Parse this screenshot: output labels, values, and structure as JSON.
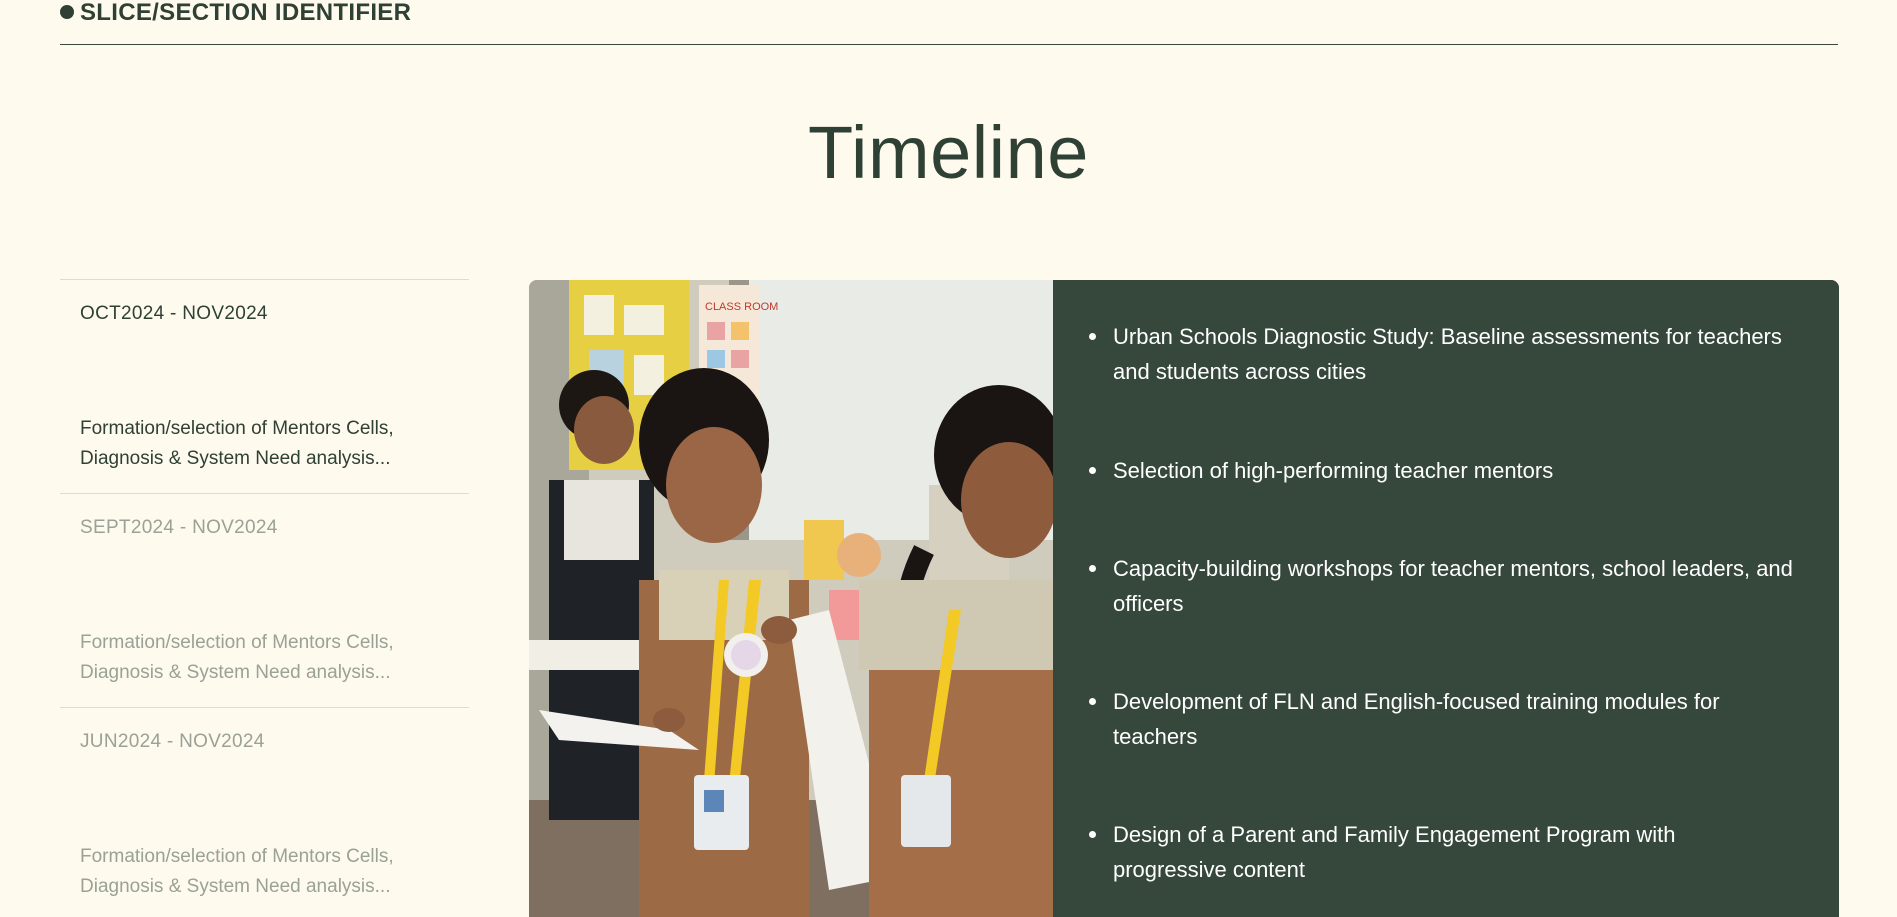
{
  "section": {
    "identifier": "SLICE/SECTION IDENTIFIER"
  },
  "page": {
    "title": "Timeline"
  },
  "timeline": {
    "items": [
      {
        "dates": "OCT2024 - NOV2024",
        "description": "Formation/selection of Mentors Cells, Diagnosis & System Need analysis...",
        "active": true
      },
      {
        "dates": "SEPT2024 - NOV2024",
        "description": "Formation/selection of Mentors Cells, Diagnosis & System Need analysis...",
        "active": false
      },
      {
        "dates": "JUN2024 - NOV2024",
        "description": "Formation/selection of Mentors Cells, Diagnosis & System Need analysis...",
        "active": false
      }
    ]
  },
  "content": {
    "bullets": [
      "Urban Schools Diagnostic Study: Baseline assessments for teachers and students across cities",
      "Selection of high-performing teacher mentors",
      "Capacity-building workshops for teacher mentors, school leaders, and officers",
      "Development of FLN and English-focused training modules for teachers",
      "Design of a Parent and Family Engagement Program with progressive content"
    ],
    "photo_sign_text": "CLASS ROOM"
  },
  "colors": {
    "background": "#fffaee",
    "primary_dark_green": "#36473c",
    "text_dark": "#2f4035",
    "text_muted": "#9aa196",
    "divider": "#dcdccf"
  }
}
